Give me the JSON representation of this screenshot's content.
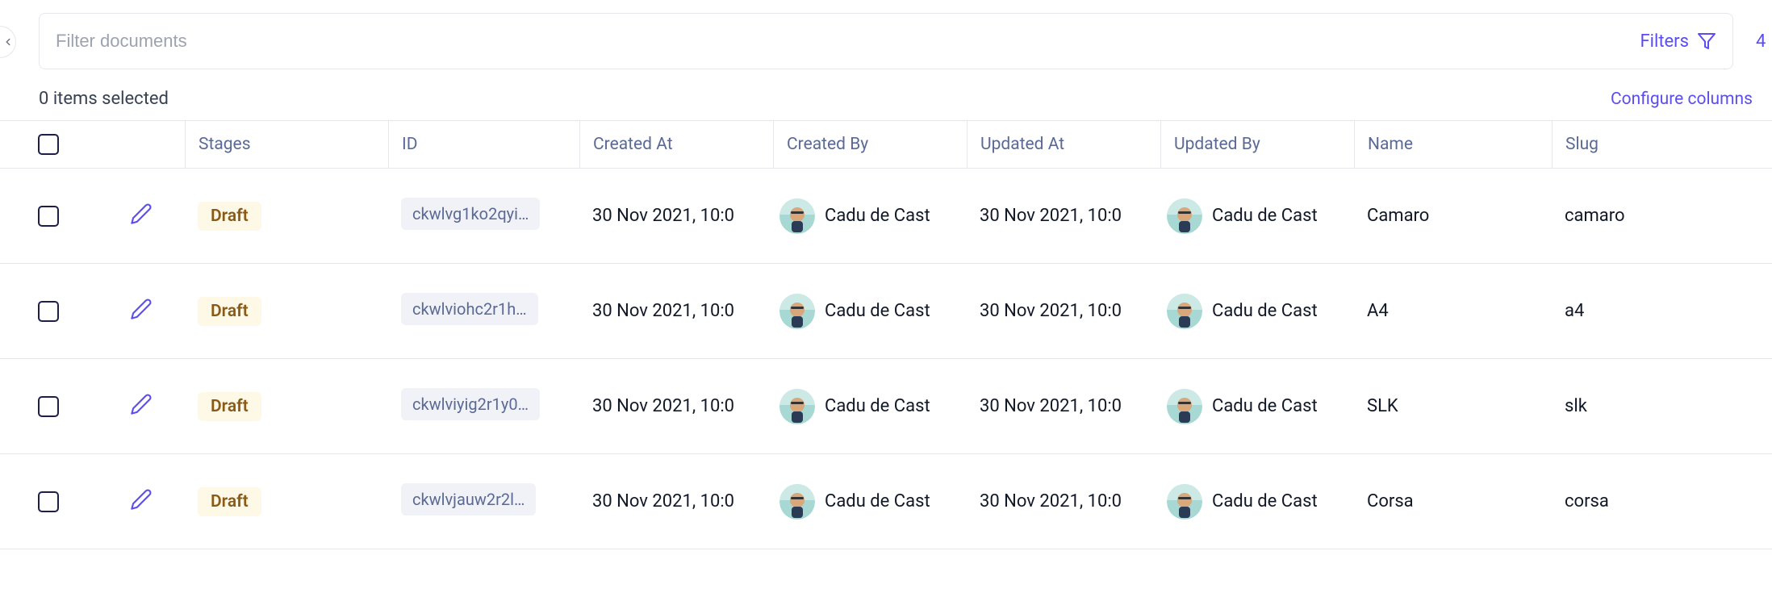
{
  "filter": {
    "placeholder": "Filter documents",
    "filters_label": "Filters",
    "entries_count": "4"
  },
  "toolbar": {
    "selected_label": "0 items selected",
    "configure_label": "Configure columns"
  },
  "columns": {
    "stages": "Stages",
    "id": "ID",
    "created_at": "Created At",
    "created_by": "Created By",
    "updated_at": "Updated At",
    "updated_by": "Updated By",
    "name": "Name",
    "slug": "Slug"
  },
  "rows": [
    {
      "stage": "Draft",
      "id": "ckwlvg1ko2qyi…",
      "created_at": "30 Nov 2021, 10:0",
      "created_by": "Cadu de Cast",
      "updated_at": "30 Nov 2021, 10:0",
      "updated_by": "Cadu de Cast",
      "name": "Camaro",
      "slug": "camaro"
    },
    {
      "stage": "Draft",
      "id": "ckwlviohc2r1h…",
      "created_at": "30 Nov 2021, 10:0",
      "created_by": "Cadu de Cast",
      "updated_at": "30 Nov 2021, 10:0",
      "updated_by": "Cadu de Cast",
      "name": "A4",
      "slug": "a4"
    },
    {
      "stage": "Draft",
      "id": "ckwlviyig2r1y0…",
      "created_at": "30 Nov 2021, 10:0",
      "created_by": "Cadu de Cast",
      "updated_at": "30 Nov 2021, 10:0",
      "updated_by": "Cadu de Cast",
      "name": "SLK",
      "slug": "slk"
    },
    {
      "stage": "Draft",
      "id": "ckwlvjauw2r2l…",
      "created_at": "30 Nov 2021, 10:0",
      "created_by": "Cadu de Cast",
      "updated_at": "30 Nov 2021, 10:0",
      "updated_by": "Cadu de Cast",
      "name": "Corsa",
      "slug": "corsa"
    }
  ]
}
